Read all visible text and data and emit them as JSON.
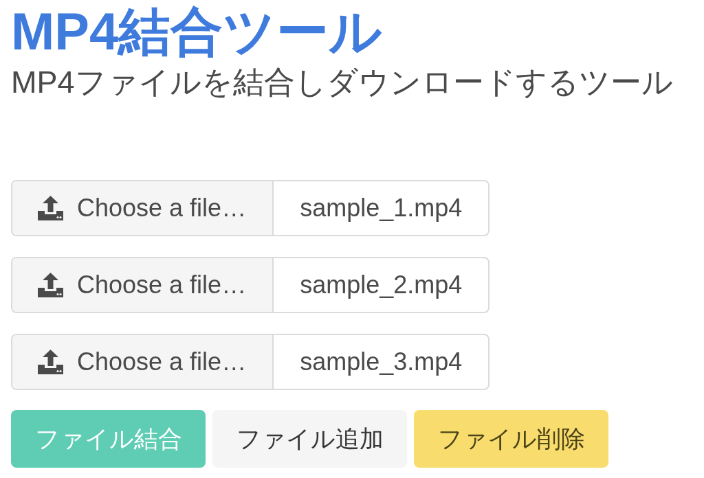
{
  "header": {
    "title": "MP4結合ツール",
    "subtitle": "MP4ファイルを結合しダウンロードするツール"
  },
  "file_inputs": [
    {
      "label": "Choose a file…",
      "file_name": "sample_1.mp4"
    },
    {
      "label": "Choose a file…",
      "file_name": "sample_2.mp4"
    },
    {
      "label": "Choose a file…",
      "file_name": "sample_3.mp4"
    }
  ],
  "buttons": [
    {
      "label": "ファイル結合",
      "kind": "primary"
    },
    {
      "label": "ファイル追加",
      "kind": "light"
    },
    {
      "label": "ファイル削除",
      "kind": "warning"
    }
  ]
}
